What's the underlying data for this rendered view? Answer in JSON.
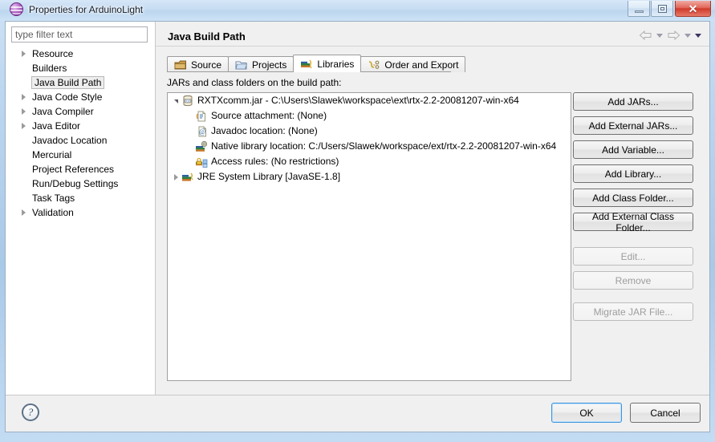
{
  "window": {
    "title": "Properties for ArduinoLight",
    "app_icon": "eclipse-sphere-icon",
    "controls": {
      "minimize": "minimize-icon",
      "maximize": "maximize-icon",
      "close": "✕"
    }
  },
  "sidebar": {
    "filter_placeholder": "type filter text",
    "filter_value": "",
    "items": [
      {
        "label": "Resource",
        "expandable": true,
        "selected": false
      },
      {
        "label": "Builders",
        "expandable": false,
        "selected": false
      },
      {
        "label": "Java Build Path",
        "expandable": false,
        "selected": true
      },
      {
        "label": "Java Code Style",
        "expandable": true,
        "selected": false
      },
      {
        "label": "Java Compiler",
        "expandable": true,
        "selected": false
      },
      {
        "label": "Java Editor",
        "expandable": true,
        "selected": false
      },
      {
        "label": "Javadoc Location",
        "expandable": false,
        "selected": false
      },
      {
        "label": "Mercurial",
        "expandable": false,
        "selected": false
      },
      {
        "label": "Project References",
        "expandable": false,
        "selected": false
      },
      {
        "label": "Run/Debug Settings",
        "expandable": false,
        "selected": false
      },
      {
        "label": "Task Tags",
        "expandable": false,
        "selected": false
      },
      {
        "label": "Validation",
        "expandable": true,
        "selected": false
      }
    ]
  },
  "page": {
    "title": "Java Build Path",
    "nav": {
      "back": "back-arrow-icon",
      "back_menu": "chevron-down-icon",
      "forward": "forward-arrow-icon",
      "forward_menu": "chevron-down-icon",
      "view_menu": "chevron-down-icon"
    },
    "tabs": [
      {
        "label": "Source",
        "icon": "source-package-icon",
        "active": false
      },
      {
        "label": "Projects",
        "icon": "open-folder-icon",
        "active": false
      },
      {
        "label": "Libraries",
        "icon": "books-icon",
        "active": true
      },
      {
        "label": "Order and Export",
        "icon": "order-arrows-icon",
        "active": false
      }
    ],
    "tree_label": "JARs and class folders on the build path:",
    "tree": [
      {
        "label": "RXTXcomm.jar - C:\\Users\\Slawek\\workspace\\ext\\rtx-2.2-20081207-win-x64",
        "icon": "jar-file-icon",
        "level": 0,
        "twisty": "open"
      },
      {
        "label": "Source attachment: (None)",
        "icon": "source-attachment-icon",
        "level": 1,
        "twisty": "none"
      },
      {
        "label": "Javadoc location: (None)",
        "icon": "javadoc-icon",
        "level": 1,
        "twisty": "none"
      },
      {
        "label": "Native library location: C:/Users/Slawek/workspace/ext/rtx-2.2-20081207-win-x64",
        "icon": "native-library-icon",
        "level": 1,
        "twisty": "none"
      },
      {
        "label": "Access rules: (No restrictions)",
        "icon": "access-rules-icon",
        "level": 1,
        "twisty": "none"
      },
      {
        "label": "JRE System Library [JavaSE-1.8]",
        "icon": "jre-library-icon",
        "level": 0,
        "twisty": "closed"
      }
    ],
    "side_buttons": [
      {
        "label": "Add JARs...",
        "enabled": true
      },
      {
        "label": "Add External JARs...",
        "enabled": true
      },
      {
        "label": "Add Variable...",
        "enabled": true
      },
      {
        "label": "Add Library...",
        "enabled": true
      },
      {
        "label": "Add Class Folder...",
        "enabled": true
      },
      {
        "label": "Add External Class Folder...",
        "enabled": true
      },
      {
        "label": "Edit...",
        "enabled": false
      },
      {
        "label": "Remove",
        "enabled": false
      },
      {
        "label": "Migrate JAR File...",
        "enabled": false
      }
    ]
  },
  "footer": {
    "help_icon": "help-question-icon",
    "help_glyph": "?",
    "ok_label": "OK",
    "cancel_label": "Cancel"
  },
  "colors": {
    "accent_blue": "#3c94e0",
    "close_red": "#cf3a2b",
    "title_bar": "#c6dcf2",
    "dialog_bg": "#f0f0f0",
    "panel_white": "#ffffff",
    "selection_grey": "#eeeeee"
  }
}
